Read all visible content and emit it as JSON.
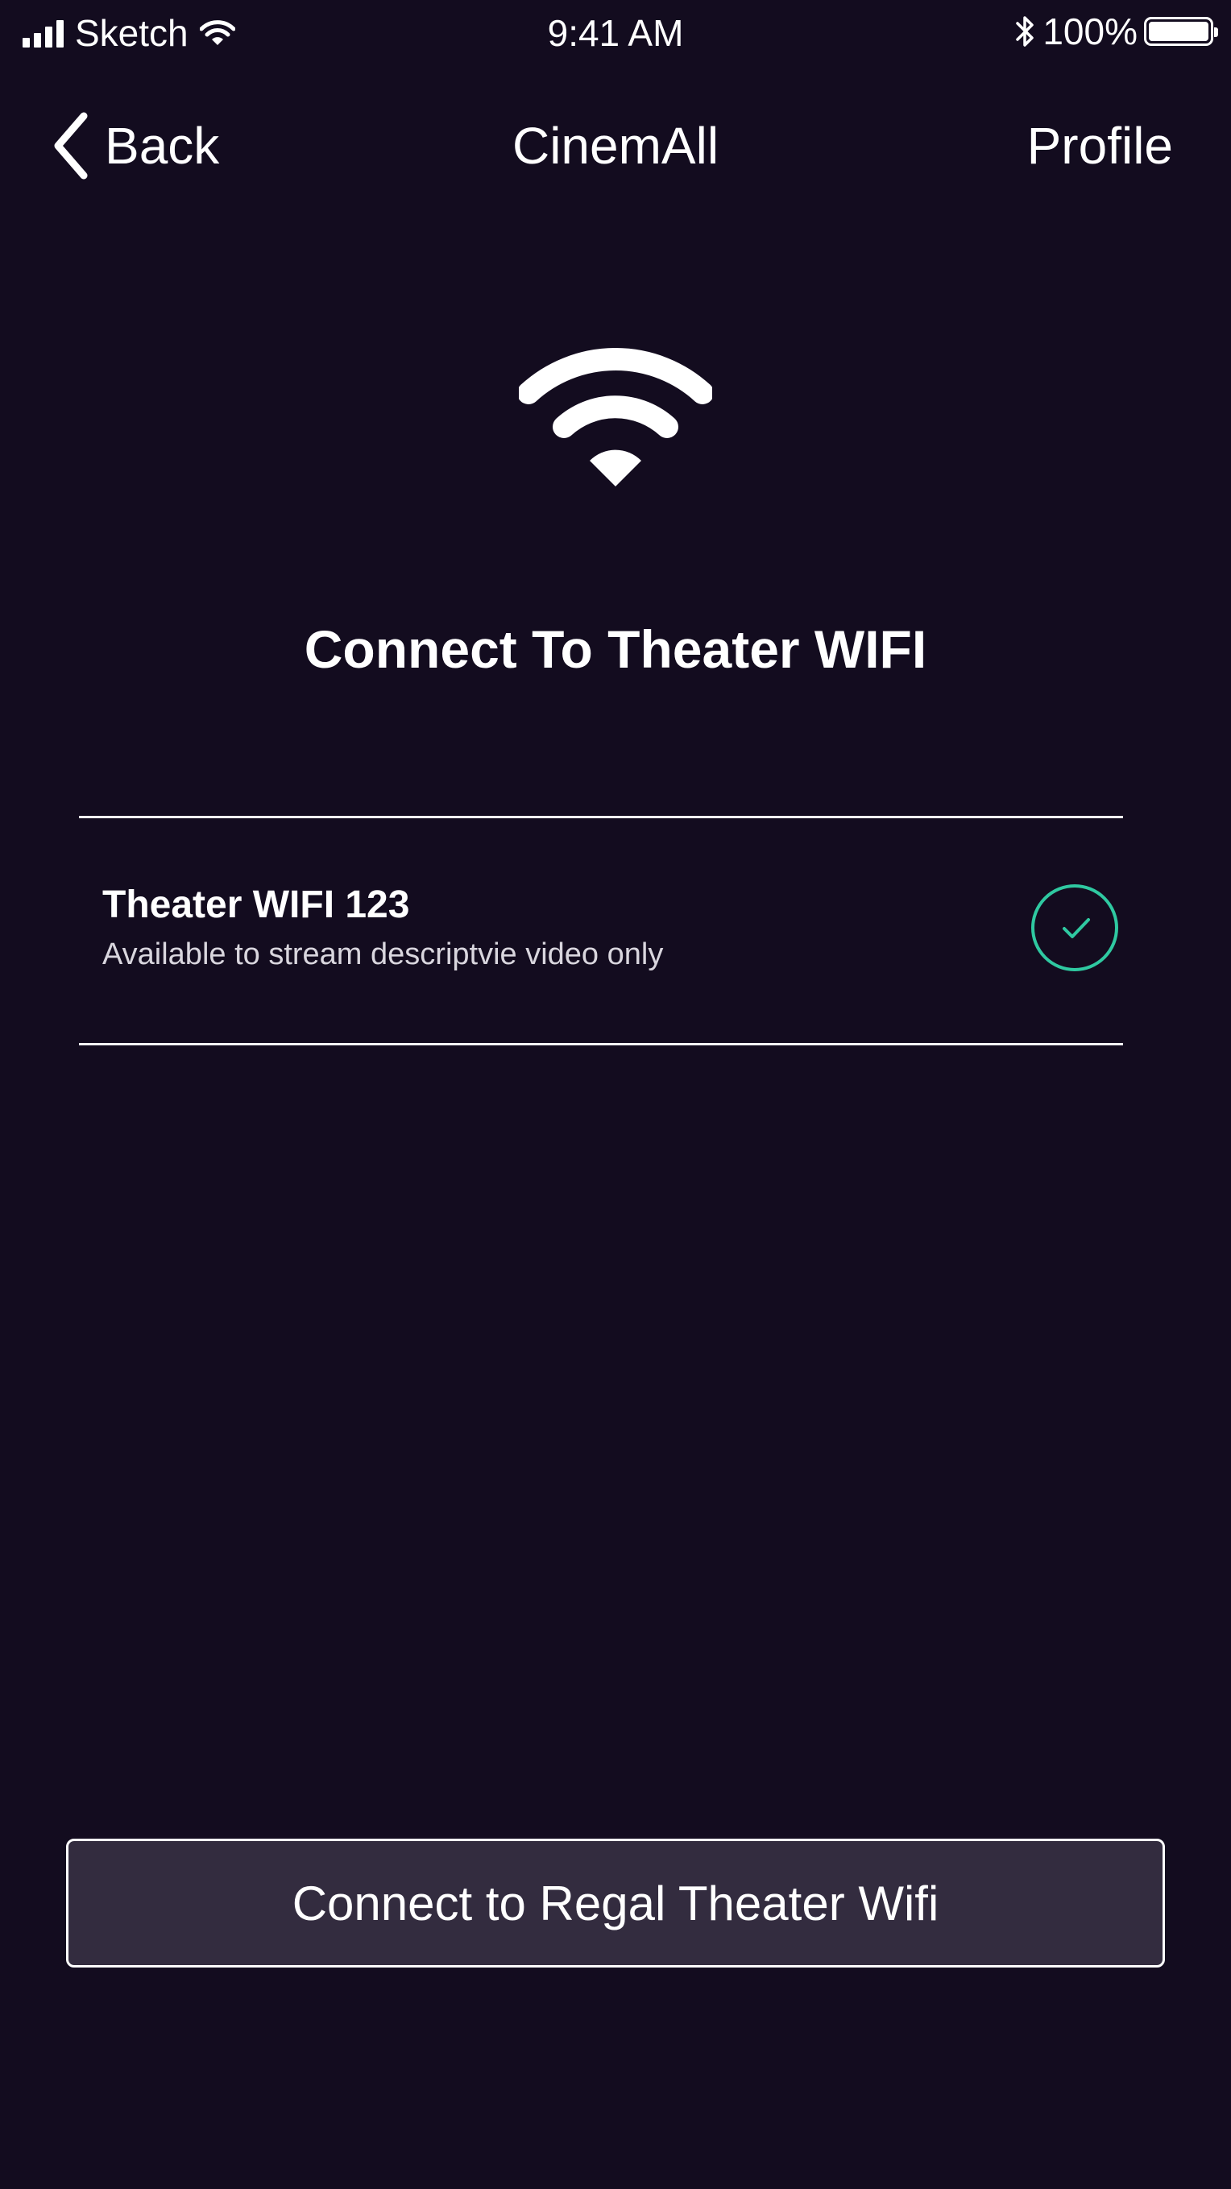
{
  "status_bar": {
    "carrier": "Sketch",
    "time": "9:41 AM",
    "battery": "100%",
    "battery_level": 1.0
  },
  "nav": {
    "back_label": "Back",
    "title": "CinemAll",
    "profile_label": "Profile"
  },
  "heading": "Connect To Theater WIFI",
  "network": {
    "name": "Theater WIFI 123",
    "description": "Available to stream descriptvie video only",
    "selected": true
  },
  "primary_button": {
    "label": "Connect to Regal Theater Wifi"
  },
  "colors": {
    "background": "#130c1f",
    "button_fill": "#332c3f",
    "accent": "#2fc9a1",
    "text": "#ffffff"
  },
  "icons": {
    "back": "chevron-left-icon",
    "hero": "wifi-icon",
    "selection": "check-circle-icon"
  }
}
